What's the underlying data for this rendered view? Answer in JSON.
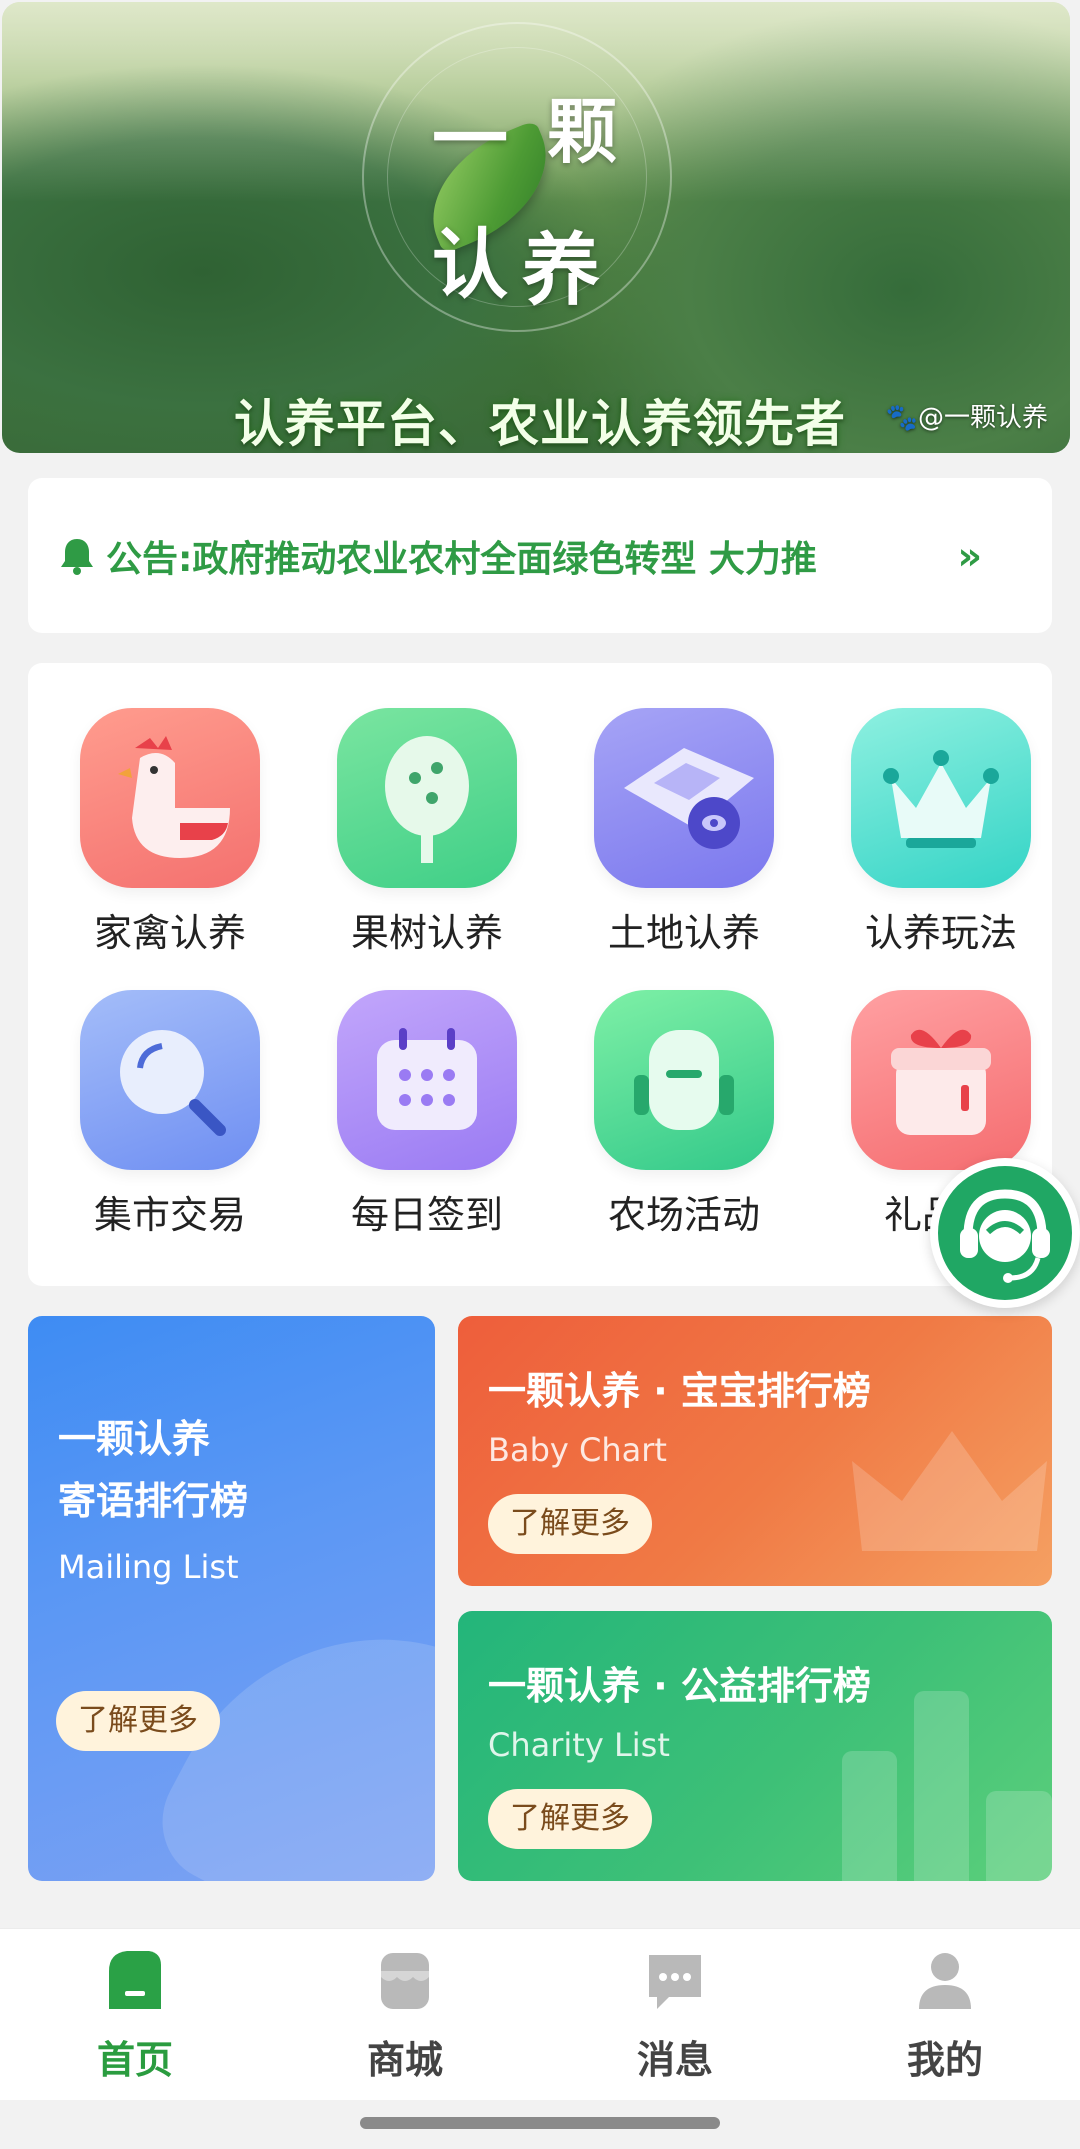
{
  "banner": {
    "calligraphy": [
      "一",
      "颗",
      "认",
      "养"
    ],
    "slogan": "认养平台、农业认养领先者",
    "watermark": "🐾@一颗认养"
  },
  "notice": {
    "icon": "bell-icon",
    "text": "公告:政府推动农业农村全面绿色转型 大力推",
    "more_icon": "»"
  },
  "grid": {
    "items": [
      {
        "label": "家禽认养",
        "icon": "chicken-icon",
        "color": "#f4716f"
      },
      {
        "label": "果树认养",
        "icon": "tree-icon",
        "color": "#3fcf87"
      },
      {
        "label": "土地认养",
        "icon": "land-icon",
        "color": "#7b78ee"
      },
      {
        "label": "认养玩法",
        "icon": "crown-icon",
        "color": "#34d4c6"
      },
      {
        "label": "集市交易",
        "icon": "search-icon",
        "color": "#6f8ff2"
      },
      {
        "label": "每日签到",
        "icon": "calendar-icon",
        "color": "#9a7bf3"
      },
      {
        "label": "农场活动",
        "icon": "backpack-icon",
        "color": "#33c98a"
      },
      {
        "label": "礼品兑",
        "icon": "gift-icon",
        "color": "#f56d70"
      }
    ]
  },
  "promos": {
    "mailing": {
      "line1": "一颗认养",
      "line2": "寄语排行榜",
      "sub": "Mailing List",
      "button": "了解更多"
    },
    "baby": {
      "title": "一颗认养 · 宝宝排行榜",
      "sub": "Baby Chart",
      "button": "了解更多"
    },
    "charity": {
      "title": "一颗认养 · 公益排行榜",
      "sub": "Charity List",
      "button": "了解更多"
    }
  },
  "support_icon": "customer-service-icon",
  "nav": {
    "items": [
      {
        "label": "首页",
        "icon": "home-icon",
        "active": true
      },
      {
        "label": "商城",
        "icon": "shop-icon",
        "active": false
      },
      {
        "label": "消息",
        "icon": "message-icon",
        "active": false
      },
      {
        "label": "我的",
        "icon": "user-icon",
        "active": false
      }
    ]
  },
  "colors": {
    "accent": "#2a9c3f",
    "notice": "#2f9b45"
  }
}
